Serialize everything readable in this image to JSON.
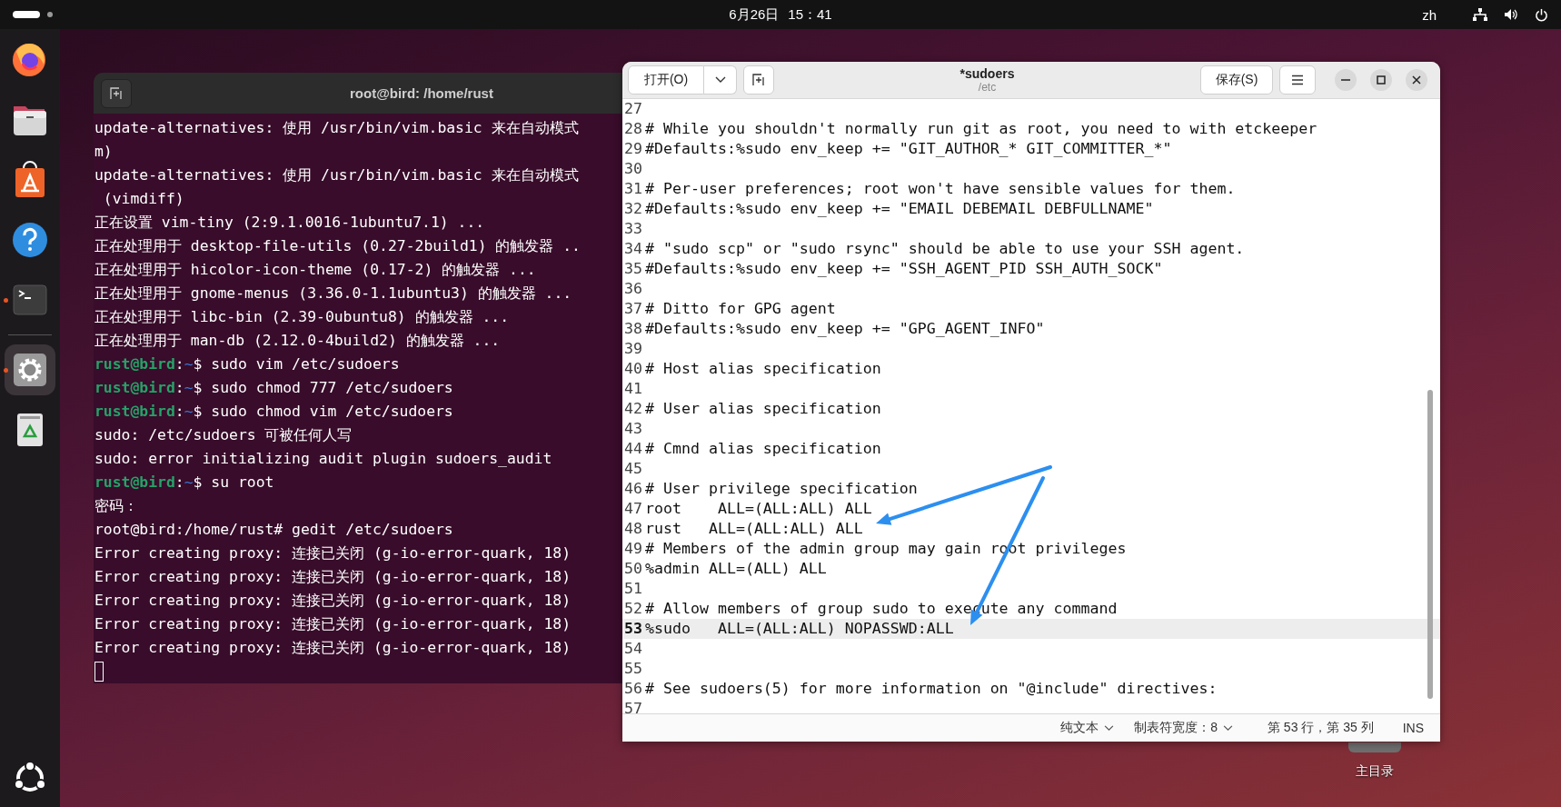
{
  "top_bar": {
    "date": "6月26日",
    "time": "15：41",
    "input_method": "zh"
  },
  "dock": {
    "items": [
      {
        "kind": "firefox",
        "running": false,
        "selected": false
      },
      {
        "kind": "files",
        "running": false,
        "selected": false
      },
      {
        "kind": "app-center",
        "running": false,
        "selected": false
      },
      {
        "kind": "help",
        "running": false,
        "selected": false
      },
      {
        "kind": "terminal",
        "running": true,
        "selected": false
      },
      {
        "kind": "settings",
        "running": true,
        "selected": true
      },
      {
        "kind": "trash",
        "running": false,
        "selected": false
      }
    ]
  },
  "desktop_icons": [
    {
      "label": "主目录"
    }
  ],
  "terminal": {
    "title": "root@bird: /home/rust",
    "lines": [
      {
        "kind": "output",
        "text": "update-alternatives: 使用 /usr/bin/vim.basic 来在自动模式"
      },
      {
        "kind": "output",
        "text": "m)"
      },
      {
        "kind": "output",
        "text": "update-alternatives: 使用 /usr/bin/vim.basic 来在自动模式"
      },
      {
        "kind": "output",
        "text": " (vimdiff)"
      },
      {
        "kind": "output",
        "text": "正在设置 vim-tiny (2:9.1.0016-1ubuntu7.1) ..."
      },
      {
        "kind": "output",
        "text": "正在处理用于 desktop-file-utils (0.27-2build1) 的触发器 .."
      },
      {
        "kind": "output",
        "text": "正在处理用于 hicolor-icon-theme (0.17-2) 的触发器 ..."
      },
      {
        "kind": "output",
        "text": "正在处理用于 gnome-menus (3.36.0-1.1ubuntu3) 的触发器 ..."
      },
      {
        "kind": "output",
        "text": "正在处理用于 libc-bin (2.39-0ubuntu8) 的触发器 ..."
      },
      {
        "kind": "output",
        "text": "正在处理用于 man-db (2.12.0-4build2) 的触发器 ..."
      },
      {
        "kind": "prompt",
        "user": "rust@bird",
        "separator": ":",
        "path": "~",
        "command": "$ sudo vim /etc/sudoers"
      },
      {
        "kind": "prompt",
        "user": "rust@bird",
        "separator": ":",
        "path": "~",
        "command": "$ sudo chmod 777 /etc/sudoers"
      },
      {
        "kind": "prompt",
        "user": "rust@bird",
        "separator": ":",
        "path": "~",
        "command": "$ sudo chmod vim /etc/sudoers"
      },
      {
        "kind": "output",
        "text": "sudo: /etc/sudoers 可被任何人写"
      },
      {
        "kind": "output",
        "text": "sudo: error initializing audit plugin sudoers_audit"
      },
      {
        "kind": "prompt",
        "user": "rust@bird",
        "separator": ":",
        "path": "~",
        "command": "$ su root"
      },
      {
        "kind": "output",
        "text": "密码："
      },
      {
        "kind": "output",
        "text": "root@bird:/home/rust# gedit /etc/sudoers"
      },
      {
        "kind": "output",
        "text": "Error creating proxy: 连接已关闭 (g-io-error-quark, 18)"
      },
      {
        "kind": "output",
        "text": "Error creating proxy: 连接已关闭 (g-io-error-quark, 18)"
      },
      {
        "kind": "output",
        "text": "Error creating proxy: 连接已关闭 (g-io-error-quark, 18)"
      },
      {
        "kind": "output",
        "text": "Error creating proxy: 连接已关闭 (g-io-error-quark, 18)"
      },
      {
        "kind": "output",
        "text": "Error creating proxy: 连接已关闭 (g-io-error-quark, 18)"
      },
      {
        "kind": "cursor"
      }
    ]
  },
  "editor": {
    "title": "*sudoers",
    "subtitle": "/etc",
    "open_button": "打开(O)",
    "save_button": "保存(S)",
    "lines": [
      {
        "number": "27",
        "selected": false
      },
      {
        "number": "28",
        "text": "# While you shouldn't normally run git as root, you need to with etckeeper",
        "selected": false
      },
      {
        "number": "29",
        "text": "#Defaults:%sudo env_keep += \"GIT_AUTHOR_* GIT_COMMITTER_*\"",
        "selected": false
      },
      {
        "number": "30",
        "selected": false
      },
      {
        "number": "31",
        "text": "# Per-user preferences; root won't have sensible values for them.",
        "selected": false
      },
      {
        "number": "32",
        "text": "#Defaults:%sudo env_keep += \"EMAIL DEBEMAIL DEBFULLNAME\"",
        "selected": false
      },
      {
        "number": "33",
        "selected": false
      },
      {
        "number": "34",
        "text": "# \"sudo scp\" or \"sudo rsync\" should be able to use your SSH agent.",
        "selected": false
      },
      {
        "number": "35",
        "text": "#Defaults:%sudo env_keep += \"SSH_AGENT_PID SSH_AUTH_SOCK\"",
        "selected": false
      },
      {
        "number": "36",
        "selected": false
      },
      {
        "number": "37",
        "text": "# Ditto for GPG agent",
        "selected": false
      },
      {
        "number": "38",
        "text": "#Defaults:%sudo env_keep += \"GPG_AGENT_INFO\"",
        "selected": false
      },
      {
        "number": "39",
        "selected": false
      },
      {
        "number": "40",
        "text": "# Host alias specification",
        "selected": false
      },
      {
        "number": "41",
        "selected": false
      },
      {
        "number": "42",
        "text": "# User alias specification",
        "selected": false
      },
      {
        "number": "43",
        "selected": false
      },
      {
        "number": "44",
        "text": "# Cmnd alias specification",
        "selected": false
      },
      {
        "number": "45",
        "selected": false
      },
      {
        "number": "46",
        "text": "# User privilege specification",
        "selected": false
      },
      {
        "number": "47",
        "text": "root    ALL=(ALL:ALL) ALL",
        "selected": false
      },
      {
        "number": "48",
        "text": "rust   ALL=(ALL:ALL) ALL",
        "selected": false
      },
      {
        "number": "49",
        "text": "# Members of the admin group may gain root privileges",
        "selected": false
      },
      {
        "number": "50",
        "text": "%admin ALL=(ALL) ALL",
        "selected": false
      },
      {
        "number": "51",
        "selected": false
      },
      {
        "number": "52",
        "text": "# Allow members of group sudo to execute any command",
        "selected": false
      },
      {
        "number": "53",
        "text": "%sudo   ALL=(ALL:ALL) NOPASSWD:ALL",
        "selected": true
      },
      {
        "number": "54",
        "selected": false
      },
      {
        "number": "55",
        "selected": false
      },
      {
        "number": "56",
        "text": "# See sudoers(5) for more information on \"@include\" directives:",
        "selected": false
      },
      {
        "number": "57",
        "selected": false
      }
    ],
    "status_bar": {
      "language": "纯文本",
      "tab_width": "制表符宽度：8",
      "position": "第 53 行，第 35 列",
      "mode": "INS"
    }
  }
}
